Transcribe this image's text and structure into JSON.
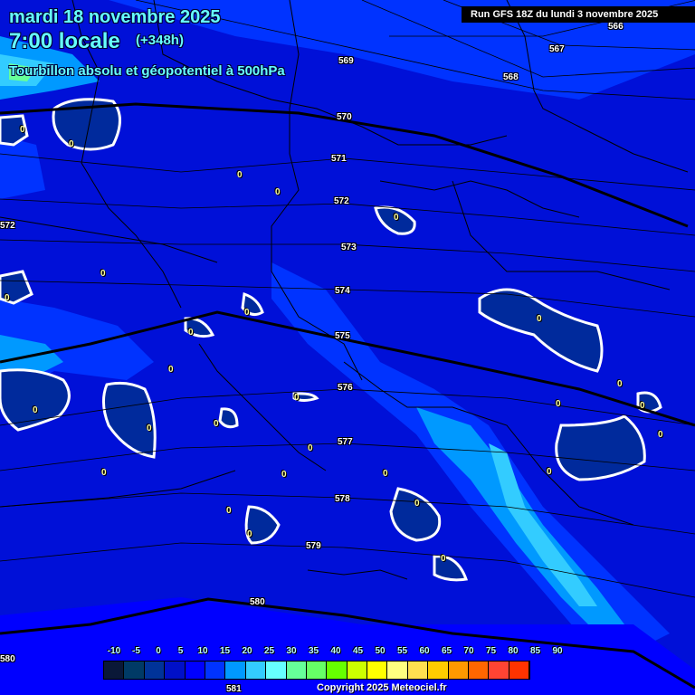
{
  "header": {
    "date": "mardi 18 novembre 2025",
    "time": "7:00 locale",
    "lead": "(+348h)",
    "parameter": "Tourbillon absolu et géopotentiel à 500hPa",
    "run": "Run GFS 18Z du lundi 3 novembre 2025"
  },
  "geopotential_labels": [
    {
      "text": "566"
    },
    {
      "text": "567"
    },
    {
      "text": "568"
    },
    {
      "text": "569"
    },
    {
      "text": "570"
    },
    {
      "text": "571"
    },
    {
      "text": "572"
    },
    {
      "text": "573"
    },
    {
      "text": "574"
    },
    {
      "text": "575"
    },
    {
      "text": "576"
    },
    {
      "text": "577"
    },
    {
      "text": "578"
    },
    {
      "text": "579"
    },
    {
      "text": "580"
    },
    {
      "text": "581"
    },
    {
      "text": "580"
    },
    {
      "text": "572"
    }
  ],
  "vorticity_zero_label": "0",
  "legend": {
    "labels": [
      "-10",
      "-5",
      "0",
      "5",
      "10",
      "15",
      "20",
      "25",
      "30",
      "35",
      "40",
      "45",
      "50",
      "55",
      "60",
      "65",
      "70",
      "75",
      "80",
      "85",
      "90"
    ],
    "colors": [
      "#0a1838",
      "#003a66",
      "#003399",
      "#0010c8",
      "#0000ff",
      "#0033ff",
      "#0099ff",
      "#33ccff",
      "#66ffff",
      "#66ff99",
      "#66ff66",
      "#66ff00",
      "#ccff00",
      "#ffff00",
      "#ffff80",
      "#ffe050",
      "#ffcc00",
      "#ff9900",
      "#ff6600",
      "#ff4433",
      "#ff3300"
    ]
  },
  "copyright": "Copyright 2025 Meteociel.fr"
}
